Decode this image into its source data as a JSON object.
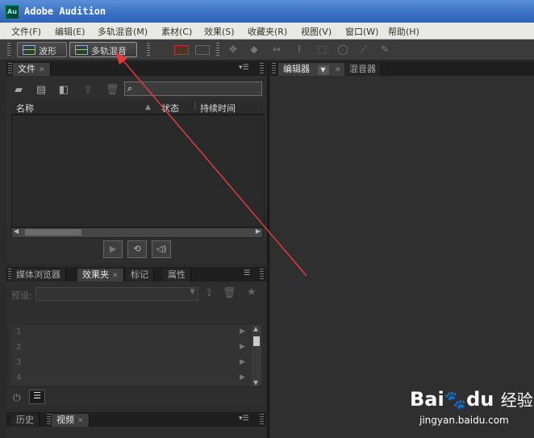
{
  "window": {
    "app_icon": "Au",
    "title": "Adobe Audition"
  },
  "menu": [
    "文件(F)",
    "编辑(E)",
    "多轨混音(M)",
    "素材(C)",
    "效果(S)",
    "收藏夹(R)",
    "视图(V)",
    "窗口(W)",
    "帮助(H)"
  ],
  "toolbar": {
    "waveform_label": "波形",
    "multitrack_label": "多轨混音"
  },
  "files_panel": {
    "tab_label": "文件",
    "columns": {
      "name": "名称",
      "status": "状态",
      "duration": "持续时间"
    }
  },
  "editor_panel": {
    "tabs": [
      "编辑器",
      "混音器"
    ]
  },
  "effects_panel": {
    "tabs": [
      "媒体浏览器",
      "效果夹",
      "标记",
      "属性"
    ],
    "preset_label": "预设:",
    "rows": [
      "1",
      "2",
      "3",
      "4"
    ]
  },
  "bottom_panel": {
    "tabs": [
      "历史",
      "视频"
    ]
  },
  "watermark": {
    "brand": "Bai",
    "brand_du": "du",
    "cn": "经验",
    "url": "jingyan.baidu.com"
  },
  "colors": {
    "title_bar": "#3a6fc4",
    "accent_arrow": "#e23b3b",
    "panel_bg": "#2e2e2e"
  }
}
